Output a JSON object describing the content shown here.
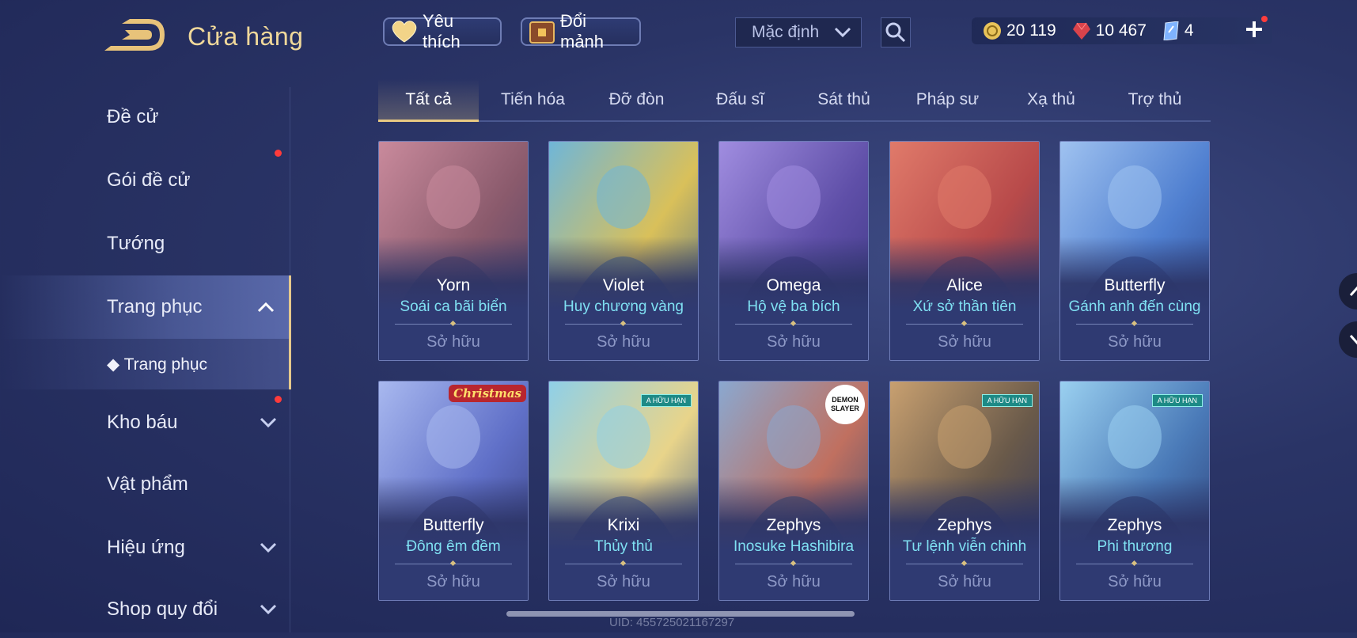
{
  "header": {
    "title": "Cửa hàng",
    "favorites_label": "Yêu thích",
    "exchange_label": "Đổi mảnh",
    "sort_label": "Mặc định",
    "currencies": [
      {
        "icon": "gold-coin-icon",
        "value": "20 119",
        "color": "#e8c35a"
      },
      {
        "icon": "ruby-icon",
        "value": "10 467",
        "color": "#d9434b"
      },
      {
        "icon": "voucher-icon",
        "value": "4",
        "color": "#7fb3ff"
      }
    ]
  },
  "sidebar": {
    "items": [
      {
        "label": "Đề cử",
        "chevron": "",
        "dot": false
      },
      {
        "label": "Gói đề cử",
        "chevron": "",
        "dot": true
      },
      {
        "label": "Tướng",
        "chevron": "",
        "dot": false
      },
      {
        "label": "Trang phục",
        "chevron": "up",
        "dot": false,
        "active": true
      },
      {
        "label": "Kho báu",
        "chevron": "down",
        "dot": true
      },
      {
        "label": "Vật phẩm",
        "chevron": "",
        "dot": false
      },
      {
        "label": "Hiệu ứng",
        "chevron": "down",
        "dot": false
      },
      {
        "label": "Shop quy đổi",
        "chevron": "down",
        "dot": false
      }
    ],
    "sub_item": "◆ Trang phục"
  },
  "tabs": [
    "Tất cả",
    "Tiến hóa",
    "Đỡ đòn",
    "Đấu sĩ",
    "Sát thủ",
    "Pháp sư",
    "Xạ thủ",
    "Trợ thủ"
  ],
  "active_tab": "Tất cả",
  "cards": [
    {
      "hero": "Yorn",
      "skin": "Soái ca bãi biển",
      "status": "Sở hữu",
      "palette": [
        "#c98a9c",
        "#8a5a6c",
        "#4e3f66"
      ],
      "tag": ""
    },
    {
      "hero": "Violet",
      "skin": "Huy chương vàng",
      "status": "Sở hữu",
      "palette": [
        "#6fb6d8",
        "#d9c05a",
        "#4a6a8a"
      ],
      "tag": ""
    },
    {
      "hero": "Omega",
      "skin": "Hộ vệ ba bích",
      "status": "Sở hữu",
      "palette": [
        "#a08de0",
        "#5f4fa8",
        "#3a3580"
      ],
      "tag": ""
    },
    {
      "hero": "Alice",
      "skin": "Xứ sở thần tiên",
      "status": "Sở hữu",
      "palette": [
        "#e07a6a",
        "#b84a4a",
        "#5a3a5a"
      ],
      "tag": ""
    },
    {
      "hero": "Butterfly",
      "skin": "Gánh anh đến cùng",
      "status": "Sở hữu",
      "palette": [
        "#9fc2f0",
        "#4f7fd0",
        "#2f4a90"
      ],
      "tag": ""
    },
    {
      "hero": "Butterfly",
      "skin": "Đông êm đềm",
      "status": "Sở hữu",
      "palette": [
        "#a8b8ef",
        "#6070c8",
        "#38407f"
      ],
      "tag": "Christmas"
    },
    {
      "hero": "Krixi",
      "skin": "Thủy thủ",
      "status": "Sở hữu",
      "palette": [
        "#8fd0e8",
        "#e8d48a",
        "#3f5a8a"
      ],
      "tag": "A HỮU HẠN"
    },
    {
      "hero": "Zephys",
      "skin": "Inosuke Hashibira",
      "status": "Sở hữu",
      "palette": [
        "#8aa8d0",
        "#c07060",
        "#3a4a70"
      ],
      "tag": "DEMON SLAYER"
    },
    {
      "hero": "Zephys",
      "skin": "Tư lệnh viễn chinh",
      "status": "Sở hữu",
      "palette": [
        "#c8a070",
        "#6a5a4a",
        "#2f3458"
      ],
      "tag": "A HỮU HẠN"
    },
    {
      "hero": "Zephys",
      "skin": "Phi thương",
      "status": "Sở hữu",
      "palette": [
        "#9ad0f0",
        "#4a7ab8",
        "#2a3a70"
      ],
      "tag": "A HỮU HẠN"
    }
  ],
  "uid_text": "UID: 455725021167297"
}
